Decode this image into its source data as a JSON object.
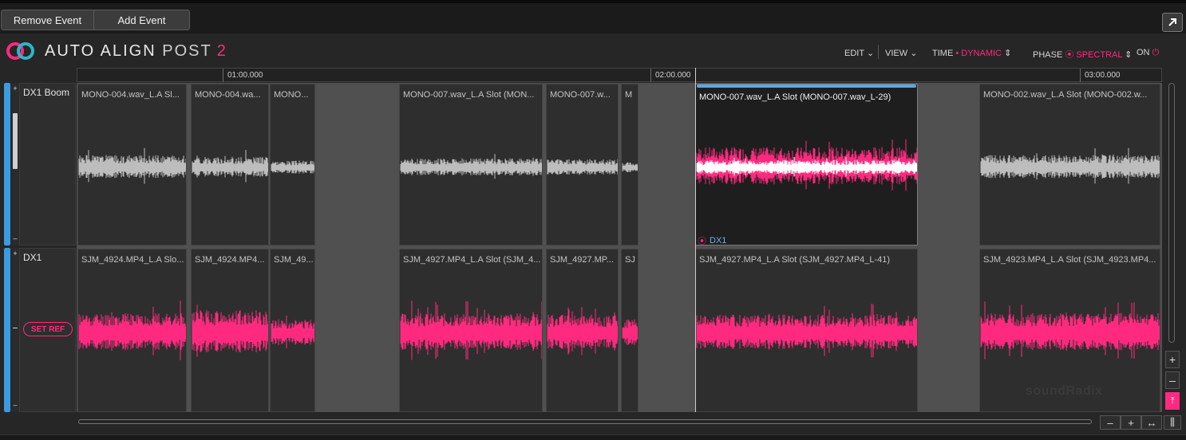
{
  "topbar": {
    "remove_event": "Remove Event",
    "add_event": "Add Event",
    "popout_icon": "arrow-up-right-icon"
  },
  "brand": {
    "name_a": "AUTO ALIGN",
    "name_b": "POST",
    "version": "2"
  },
  "toolbar": {
    "edit": "EDIT",
    "view": "VIEW",
    "time_label": "TIME",
    "time_value": "DYNAMIC",
    "phase_label": "PHASE",
    "phase_value": "SPECTRAL",
    "on_label": "ON"
  },
  "ruler": {
    "ticks": [
      "01:00.000",
      "02:00.000",
      "03:00.000"
    ]
  },
  "tracks": [
    {
      "name": "DX1 Boom",
      "clips": [
        "MONO-004.wav_L.A Sl...",
        "MONO-004.wa...",
        "MONO...",
        "MONO-007.wav_L.A Slot (MON...",
        "MONO-007.w...",
        "M",
        "MONO-007.wav_L.A Slot (MONO-007.wav_L-29)",
        "MONO-002.wav_L.A Slot (MONO-002.w..."
      ],
      "selected_clip_ref": "DX1"
    },
    {
      "name": "DX1",
      "set_ref": "SET REF",
      "clips": [
        "SJM_4924.MP4_L.A Slo...",
        "SJM_4924.MP4...",
        "SJM_49...",
        "SJM_4927.MP4_L.A Slot (SJM_4...",
        "SJM_4927.MP...",
        "SJ",
        "SJM_4927.MP4_L.A Slot (SJM_4927.MP4_L-41)",
        "SJM_4923.MP4_L.A Slot (SJM_4923.MP4..."
      ]
    }
  ],
  "colors": {
    "accent": "#ff2a7f",
    "track_blue": "#3a9be0",
    "wave_gray": "#bdbdbd"
  },
  "watermark": "soundRadix"
}
